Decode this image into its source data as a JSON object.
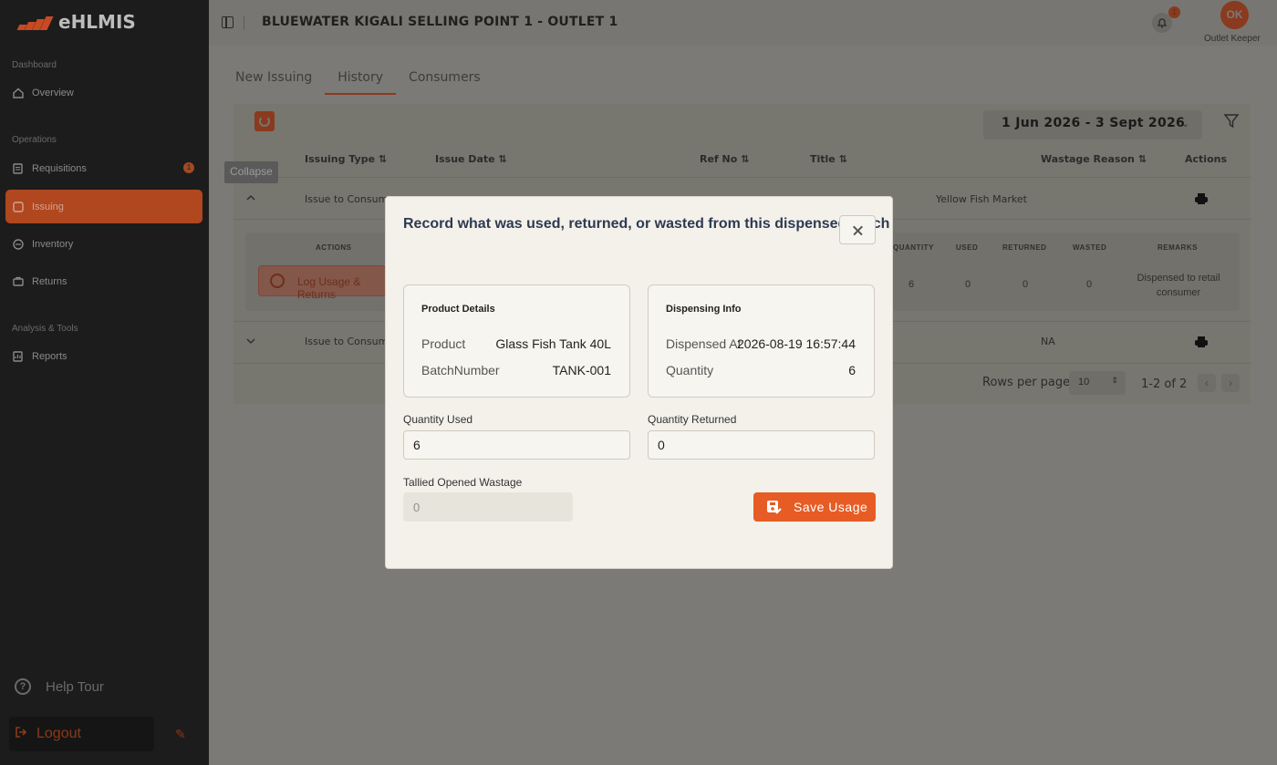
{
  "app": {
    "logo_text": "eHLMIS",
    "brand_color": "#e65c24"
  },
  "sidebar": {
    "sections": {
      "dashboard": "Dashboard",
      "operations": "Operations",
      "analysis": "Analysis & Tools"
    },
    "items": [
      {
        "label": "Overview",
        "icon": "home-icon"
      },
      {
        "label": "Requisitions",
        "icon": "document-icon",
        "badge": "1"
      },
      {
        "label": "Issuing",
        "icon": "issue-icon",
        "active": true
      },
      {
        "label": "Inventory",
        "icon": "box-icon"
      },
      {
        "label": "Returns",
        "icon": "return-icon"
      },
      {
        "label": "Reports",
        "icon": "report-icon"
      }
    ],
    "help_tour": "Help Tour",
    "logout": "Logout"
  },
  "header": {
    "title": "BLUEWATER KIGALI SELLING POINT 1 - OUTLET 1",
    "notifications": "1",
    "avatar_initials": "OK",
    "role": "Outlet Keeper"
  },
  "tabs": [
    "New Issuing",
    "History",
    "Consumers"
  ],
  "toolbar": {
    "date_range": "1 Jun 2026 - 3 Sept 2026"
  },
  "table": {
    "headers": [
      "Issuing Type",
      "Issue Date",
      "Ref No",
      "Title",
      "Wastage Reason",
      "Actions"
    ],
    "rows": [
      {
        "issuing_type": "Issue to Consumer",
        "title_tail": "Yellow Fish Market",
        "wastage": ""
      },
      {
        "issuing_type": "Issue to Consumer",
        "title_tail": "",
        "wastage": "NA"
      }
    ],
    "sub_headers": [
      "ACTIONS",
      "QUANTITY",
      "USED",
      "RETURNED",
      "WASTED",
      "REMARKS"
    ],
    "sub_row": {
      "action": "Log Usage & Returns",
      "quantity": "6",
      "used": "0",
      "returned": "0",
      "wasted": "0",
      "remarks": "Dispensed to retail consumer"
    },
    "rows_per_page_label": "Rows per page",
    "rows_per_page": "10",
    "page_count": "1-2 of 2"
  },
  "tooltip": "Collapse",
  "modal": {
    "title": "Record what was used, returned, or wasted from this dispensed batch",
    "product_details": {
      "heading": "Product Details",
      "product_label": "Product",
      "product_value": "Glass Fish Tank 40L",
      "batch_label": "BatchNumber",
      "batch_value": "TANK-001"
    },
    "dispensing_info": {
      "heading": "Dispensing Info",
      "dispensed_label": "Dispensed At",
      "dispensed_value": "2026-08-19 16:57:44",
      "quantity_label": "Quantity",
      "quantity_value": "6"
    },
    "quantity_used": {
      "label": "Quantity Used",
      "value": "6"
    },
    "quantity_returned": {
      "label": "Quantity Returned",
      "value": "0"
    },
    "tallied_wastage": {
      "label": "Tallied Opened Wastage",
      "value": "0"
    },
    "save_label": "Save Usage"
  }
}
